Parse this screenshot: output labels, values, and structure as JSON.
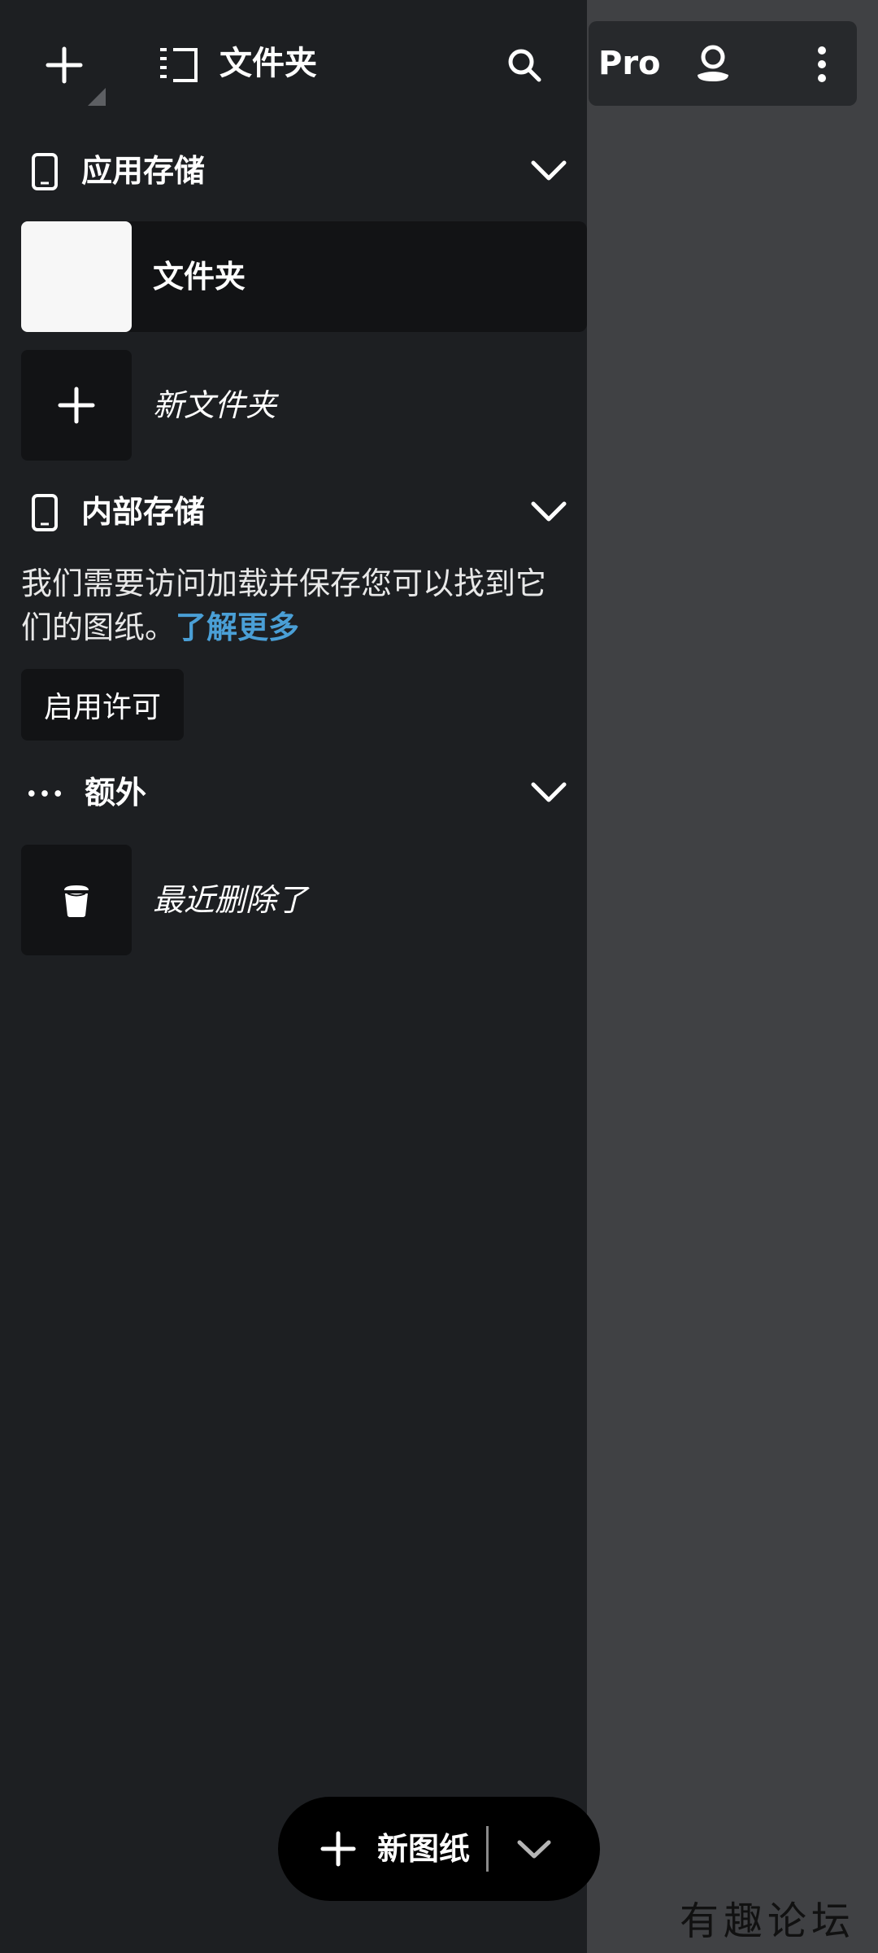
{
  "topbar": {
    "title": "文件夹",
    "add_icon": "plus-icon",
    "folder_icon": "folder-list-icon",
    "search_icon": "search-icon"
  },
  "right_toolbar": {
    "pro_label": "Pro",
    "user_icon": "user-icon",
    "more_icon": "more-vertical-icon"
  },
  "sections": {
    "app_storage": {
      "label": "应用存储",
      "icon": "phone-icon",
      "items": [
        {
          "label": "文件夹",
          "thumb": "white",
          "selected": true
        },
        {
          "label": "新文件夹",
          "thumb": "plus"
        }
      ]
    },
    "internal_storage": {
      "label": "内部存储",
      "icon": "phone-icon",
      "message": "我们需要访问加载并保存您可以找到它们的图纸。",
      "learn_more": "了解更多",
      "enable_button": "启用许可"
    },
    "extra": {
      "label": "额外",
      "icon": "dots-icon",
      "items": [
        {
          "label": "最近删除了",
          "thumb": "trash"
        }
      ]
    }
  },
  "fab": {
    "label": "新图纸",
    "plus_icon": "plus-icon",
    "chevron_icon": "chevron-down-icon"
  },
  "watermark": "有趣论坛",
  "colors": {
    "panel_bg": "#1d1f22",
    "canvas_bg": "#404144",
    "link": "#4a9fd6"
  }
}
